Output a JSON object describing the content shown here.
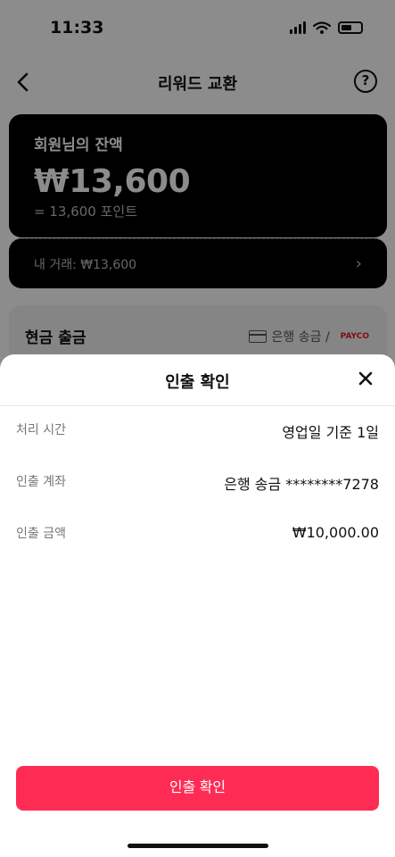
{
  "status_bar": {
    "time": "11:33"
  },
  "nav": {
    "title": "리워드 교환",
    "help": "?"
  },
  "balance": {
    "label": "회원님의 잔액",
    "amount": "₩13,600",
    "points": "= 13,600 포인트"
  },
  "transactions": {
    "label": "내 거래: ₩13,600",
    "chevron": "›"
  },
  "cash_out": {
    "title": "현금 출금",
    "method": "은행 송금 /",
    "payco": "PAYCO"
  },
  "sheet": {
    "title": "인출 확인",
    "rows": [
      {
        "label": "처리 시간",
        "value": "영업일 기준 1일"
      },
      {
        "label": "인출 계좌",
        "value": "은행 송금 ********7278"
      },
      {
        "label": "인출 금액",
        "value": "₩10,000.00"
      }
    ],
    "confirm_label": "인출 확인"
  },
  "colors": {
    "accent": "#fe2c55",
    "card": "#000000"
  },
  "icons": [
    "back-arrow-icon",
    "help-icon",
    "signal-icon",
    "wifi-icon",
    "battery-icon",
    "chevron-right-icon",
    "bank-card-icon",
    "close-icon"
  ]
}
